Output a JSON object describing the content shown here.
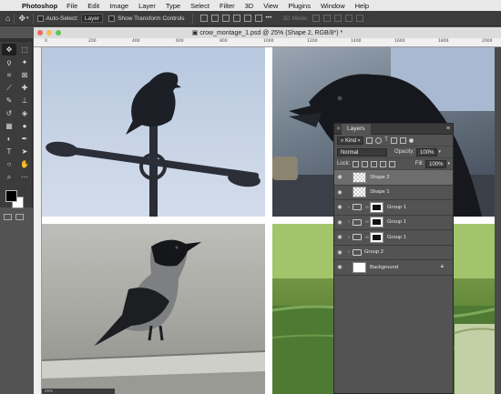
{
  "menubar": {
    "app_name": "Photoshop",
    "items": [
      "File",
      "Edit",
      "Image",
      "Layer",
      "Type",
      "Select",
      "Filter",
      "3D",
      "View",
      "Plugins",
      "Window",
      "Help"
    ]
  },
  "options_bar": {
    "auto_select_label": "Auto-Select:",
    "auto_select_value": "Layer",
    "transform_controls_label": "Show Transform Controls",
    "mode_3d_label": "3D Mode:"
  },
  "document": {
    "title": "crow_montage_1.psd @ 25% (Shape 2, RGB/8*) *",
    "ruler_ticks": [
      "0",
      "200",
      "400",
      "600",
      "800",
      "1000",
      "1200",
      "1400",
      "1600",
      "1800",
      "2000"
    ],
    "status": "25%"
  },
  "layers_panel": {
    "tab_label": "Layers",
    "filter_kind": "Kind",
    "blend_mode": "Normal",
    "opacity_label": "Opacity:",
    "opacity_value": "100%",
    "lock_label": "Lock:",
    "fill_label": "Fill:",
    "fill_value": "100%",
    "layers": [
      {
        "name": "Shape 2",
        "selected": true
      },
      {
        "name": "Shape 1",
        "selected": false
      },
      {
        "name": "Group 1",
        "selected": false
      },
      {
        "name": "Group 1",
        "selected": false
      },
      {
        "name": "Group 1",
        "selected": false
      },
      {
        "name": "Group 2",
        "selected": false
      },
      {
        "name": "Background",
        "selected": false
      }
    ]
  },
  "colors": {
    "foreground": "#000000",
    "background": "#ffffff",
    "panel": "#535353",
    "selected_layer": "#6d6d6d"
  }
}
